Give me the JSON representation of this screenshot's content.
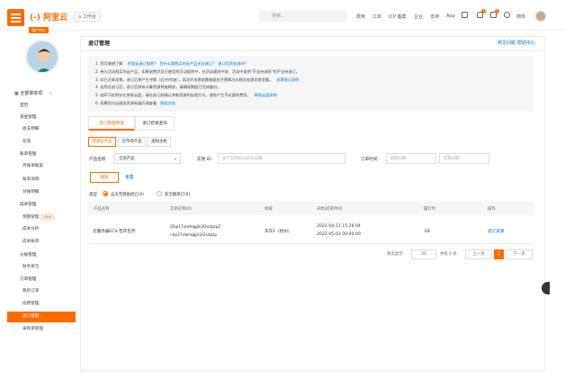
{
  "topbar": {
    "logo": "(-) 阿里云",
    "workbench": "工作台",
    "search_placeholder": "搜索...",
    "nav": [
      "费用",
      "工单",
      "ICP 备案",
      "企业",
      "支持",
      "App"
    ],
    "badges": [
      "1",
      "2"
    ],
    "lang": "简体"
  },
  "sidebar": {
    "tag": "用户中心",
    "all_products": "全部菜单项",
    "items": [
      {
        "label": "首页",
        "type": "group"
      },
      {
        "label": "资金管理",
        "type": "group"
      },
      {
        "label": "收支明细",
        "type": "sub"
      },
      {
        "label": "充值",
        "type": "sub"
      },
      {
        "label": "账单管理",
        "type": "group"
      },
      {
        "label": "月账单概览",
        "type": "sub"
      },
      {
        "label": "账单详情",
        "type": "sub"
      },
      {
        "label": "对账明细",
        "type": "sub"
      },
      {
        "label": "成本管理",
        "type": "group"
      },
      {
        "label": "预算管理",
        "type": "sub",
        "tag": "New"
      },
      {
        "label": "成本分析",
        "type": "sub"
      },
      {
        "label": "成本账单",
        "type": "sub"
      },
      {
        "label": "分账管理",
        "type": "group"
      },
      {
        "label": "财务单元",
        "type": "sub"
      },
      {
        "label": "订单管理",
        "type": "group"
      },
      {
        "label": "我的订单",
        "type": "sub"
      },
      {
        "label": "续费管理",
        "type": "sub"
      },
      {
        "label": "退订管理",
        "type": "sub",
        "active": true
      },
      {
        "label": "采购审管理",
        "type": "sub"
      }
    ]
  },
  "page": {
    "title": "退订管理",
    "faq": "常见问题",
    "help": "帮助中心"
  },
  "notice": [
    {
      "text": "1. 您可能想了解 ",
      "links": [
        "阿里云退订规则?",
        "为什么我购买的云产品无法退订?",
        "退订后资金流向?"
      ]
    },
    {
      "text": "2. 券与活动购买的云产品，如果退费涉及已使用到活动规则中，在活动规则中说：活动中说明\"不支持退款\"的不支持退订。",
      "links": []
    },
    {
      "text": "3. 如已开具发票，退订后将产生冲票（红冲/作废），再次开发票前需根据应开票情况与税务处理发票金额。",
      "links": [
        "发票退订说明"
      ]
    },
    {
      "text": "4. 若您在退订后，退订后原有计算资源将被释放，请确保数据已完成备份。",
      "links": []
    },
    {
      "text": "5. 若ECS实例存在关联云盘，请在退订前确认关联资源的处理方式，避免产生不必要的费用。",
      "links": [
        "释放云盘说明"
      ]
    },
    {
      "text": "6. 如果您对云服务资源有疑问请查看",
      "links": [
        "帮助文档"
      ]
    }
  ],
  "tabs": [
    "退订管理申请",
    "退订结果查询"
  ],
  "product_tabs": [
    "普通云产品",
    "云市场产品",
    "虚拟主机"
  ],
  "filters": {
    "product_label": "产品名称:",
    "product_value": "全部产品",
    "instance_label": "实例 ID:",
    "instance_placeholder": "多个实例ID以逗号分隔",
    "order_label": "订单时间:",
    "start_placeholder": "起始日期",
    "end_placeholder": "结束日期",
    "search": "搜索",
    "reset": "重置",
    "type_label": "类型:",
    "type_options": [
      "五天无理由退订(0)",
      "非全额退订(0)"
    ]
  },
  "table": {
    "headers": [
      "产品名称",
      "实例名称/ID",
      "地域",
      "开始/结束时间",
      "履行时",
      "操作"
    ],
    "rows": [
      {
        "product": "云服务器ECS-包年包月",
        "instance_name": "iZbp17xlwhqgjls3l2xdpzpZ",
        "instance_id": "i-bp17xlwhqgjls3l2xdpzp",
        "region": "华东1（杭州）",
        "start": "2022-04-11 15:29:04",
        "end": "2022-05-03 00:00:00",
        "duration": "3天",
        "action": "退订资源"
      }
    ]
  },
  "pager": {
    "per_page_label": "每页显示:",
    "per_page": "20",
    "total": "共有 0 条",
    "prev": "上一页",
    "current": "1",
    "next": "下一页"
  }
}
